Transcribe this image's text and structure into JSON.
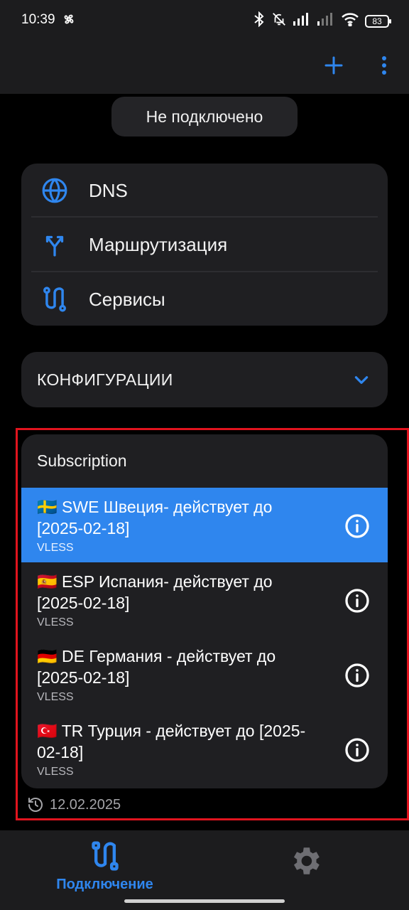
{
  "status_bar": {
    "time": "10:39",
    "battery": "83",
    "icons": [
      "fan-icon",
      "bluetooth-icon",
      "bell-off-icon",
      "signal-icon",
      "signal-weak-icon",
      "wifi-icon",
      "battery-icon"
    ]
  },
  "app_bar": {
    "actions": [
      "plus-icon",
      "more-vertical-icon"
    ]
  },
  "connection_status": "Не подключено",
  "settings": {
    "items": [
      {
        "label": "DNS",
        "icon": "globe-icon"
      },
      {
        "label": "Маршрутизация",
        "icon": "route-split-icon"
      },
      {
        "label": "Сервисы",
        "icon": "services-icon"
      }
    ]
  },
  "configurations": {
    "label": "КОНФИГУРАЦИИ",
    "icon": "chevron-down-icon"
  },
  "subscription": {
    "title": "Subscription",
    "items": [
      {
        "name": "🇸🇪 SWE Швеция- действует до [2025-02-18]",
        "type": "VLESS",
        "selected": true
      },
      {
        "name": "🇪🇸 ESP Испания- действует до [2025-02-18]",
        "type": "VLESS",
        "selected": false
      },
      {
        "name": "🇩🇪 DE Германия - действует до [2025-02-18]",
        "type": "VLESS",
        "selected": false
      },
      {
        "name": "🇹🇷 TR Турция - действует до [2025-02-18]",
        "type": "VLESS",
        "selected": false
      }
    ],
    "updated": "12.02.2025"
  },
  "bottom_nav": {
    "connection_label": "Подключение",
    "settings_icon": "gear-icon"
  },
  "colors": {
    "accent": "#2f86ee",
    "background": "#000000",
    "surface": "#1f1f22",
    "highlight_frame": "#e0141e"
  }
}
